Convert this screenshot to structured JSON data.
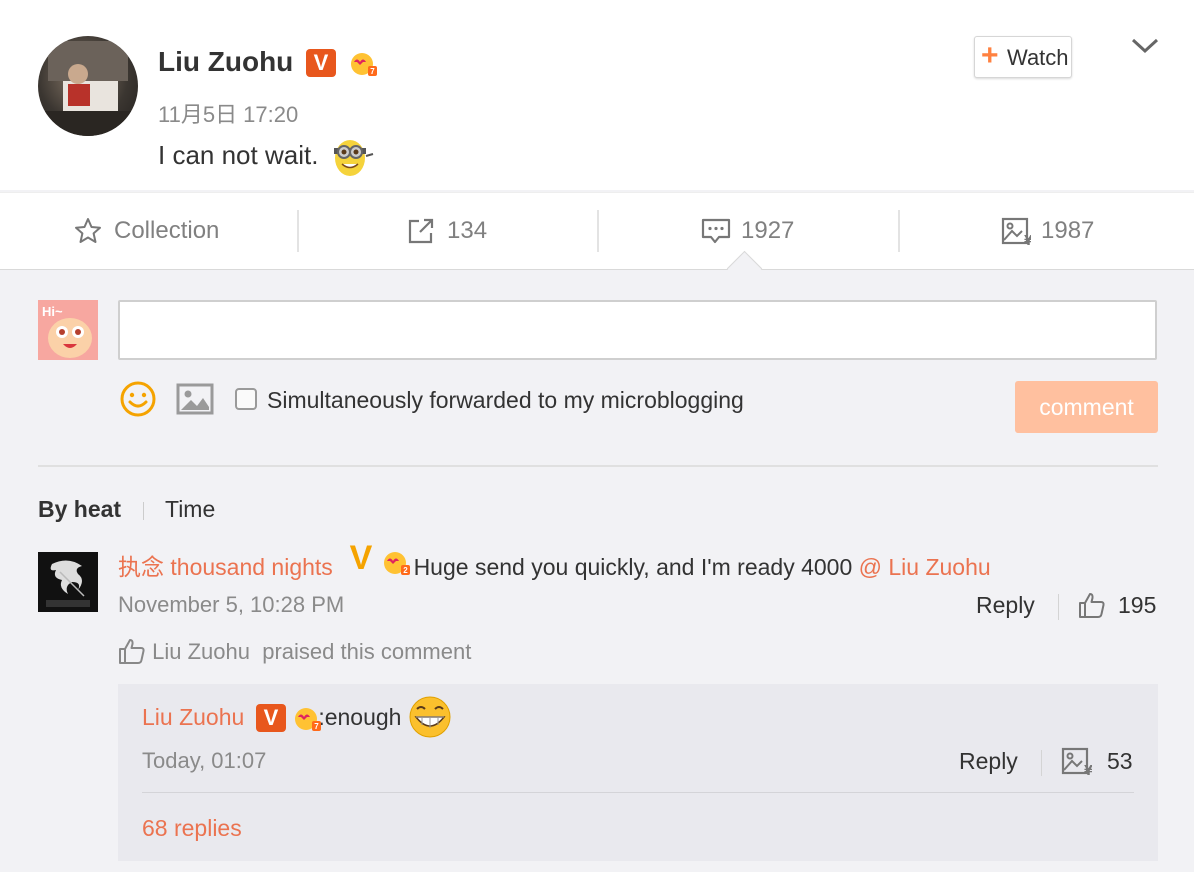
{
  "post": {
    "author": "Liu Zuohu",
    "time": "11月5日 17:20",
    "text": "I can not wait.",
    "watch_label": "Watch"
  },
  "actions": {
    "collection": "Collection",
    "forward_count": "134",
    "comment_count": "1927",
    "like_count": "1987"
  },
  "composer": {
    "placeholder": "",
    "forward_label": "Simultaneously forwarded to my microblogging",
    "submit_label": "comment"
  },
  "sort": {
    "by_heat": "By heat",
    "time": "Time"
  },
  "comment": {
    "author": "执念 thousand nights",
    "text": ": Huge send you quickly, and I'm ready 4000 ",
    "mention": "@ Liu Zuohu",
    "time": "November 5, 10:28 PM",
    "reply_label": "Reply",
    "like_count": "195",
    "praised_by": "Liu Zuohu",
    "praised_text": "praised this comment"
  },
  "reply": {
    "author": "Liu Zuohu",
    "text": ":enough",
    "time": "Today, 01:07",
    "reply_label": "Reply",
    "like_count": "53",
    "more_replies": "68 replies"
  },
  "colors": {
    "accent": "#eb7350",
    "button_disabled": "#ffc09f",
    "watch_plus": "#ff8140",
    "badge_v": "#e8571d"
  },
  "icons": [
    "chevron-down-icon",
    "star-icon",
    "share-icon",
    "comment-icon",
    "like-icon",
    "smile-icon",
    "image-icon",
    "thumb-up-icon"
  ]
}
